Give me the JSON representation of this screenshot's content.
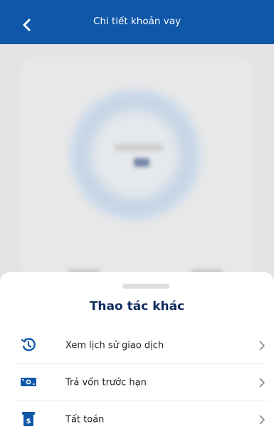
{
  "header": {
    "title": "Chi tiết khoản vay",
    "back_icon": "chevron-left-icon"
  },
  "colors": {
    "header_bg": "#0f57a9",
    "title_dark": "#0d2a5c",
    "icon_blue": "#0f57a9"
  },
  "sheet": {
    "title": "Thao tác khác",
    "items": [
      {
        "label": "Xem lịch sử giao dịch",
        "icon": "history-icon"
      },
      {
        "label": "Trả vốn trước hạn",
        "icon": "cash-icon"
      },
      {
        "label": "Tất toán",
        "icon": "receipt-icon"
      }
    ]
  }
}
